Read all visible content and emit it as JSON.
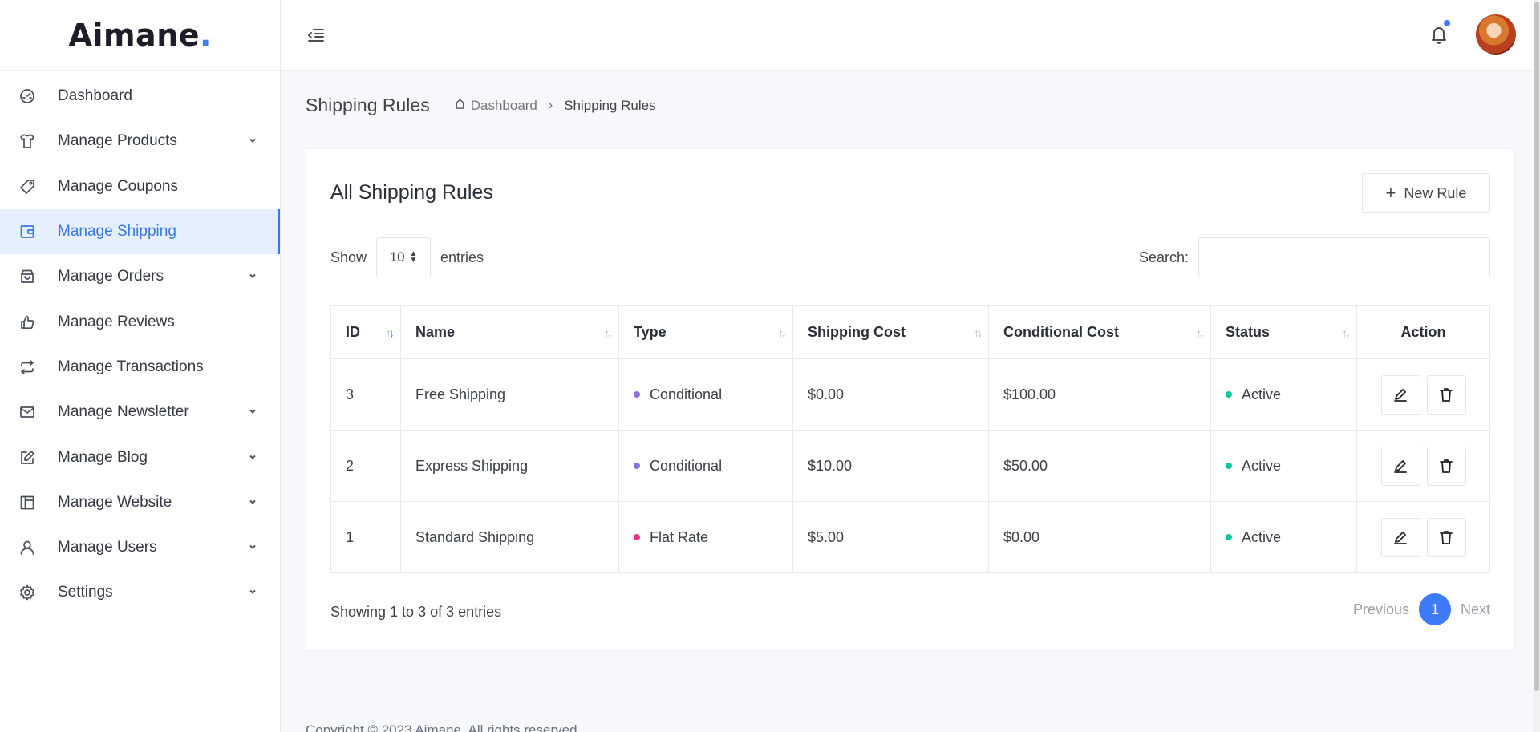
{
  "brand": {
    "name": "Aimane",
    "dot": "."
  },
  "sidebar": {
    "items": [
      {
        "label": "Dashboard",
        "icon": "dashboard-icon",
        "chevron": false,
        "active": false
      },
      {
        "label": "Manage Products",
        "icon": "shirt-icon",
        "chevron": true,
        "active": false
      },
      {
        "label": "Manage Coupons",
        "icon": "tag-icon",
        "chevron": false,
        "active": false
      },
      {
        "label": "Manage Shipping",
        "icon": "wallet-icon",
        "chevron": false,
        "active": true
      },
      {
        "label": "Manage Orders",
        "icon": "shopping-bag-icon",
        "chevron": true,
        "active": false
      },
      {
        "label": "Manage Reviews",
        "icon": "thumbs-up-icon",
        "chevron": false,
        "active": false
      },
      {
        "label": "Manage Transactions",
        "icon": "repeat-icon",
        "chevron": false,
        "active": false
      },
      {
        "label": "Manage Newsletter",
        "icon": "mail-icon",
        "chevron": true,
        "active": false
      },
      {
        "label": "Manage Blog",
        "icon": "edit-icon",
        "chevron": true,
        "active": false
      },
      {
        "label": "Manage Website",
        "icon": "layout-icon",
        "chevron": true,
        "active": false
      },
      {
        "label": "Manage Users",
        "icon": "user-icon",
        "chevron": true,
        "active": false
      },
      {
        "label": "Settings",
        "icon": "gear-icon",
        "chevron": true,
        "active": false
      }
    ]
  },
  "header": {
    "menu_icon": "menu-toggle-icon",
    "bell_icon": "bell-icon",
    "accent": "#3e7bfa"
  },
  "page": {
    "title": "Shipping Rules",
    "breadcrumb": {
      "home": "Dashboard",
      "current": "Shipping Rules"
    }
  },
  "card": {
    "title": "All Shipping Rules",
    "new_button": "New Rule",
    "show_label": "Show",
    "entries_value": "10",
    "entries_label": "entries",
    "search_label": "Search:",
    "search_value": ""
  },
  "table": {
    "columns": [
      "ID",
      "Name",
      "Type",
      "Shipping Cost",
      "Conditional Cost",
      "Status",
      "Action"
    ],
    "rows": [
      {
        "id": "3",
        "name": "Free Shipping",
        "type": "Conditional",
        "type_color": "#8b6fe8",
        "shipping_cost": "$0.00",
        "conditional_cost": "$100.00",
        "status": "Active",
        "status_color": "#12c4a0"
      },
      {
        "id": "2",
        "name": "Express Shipping",
        "type": "Conditional",
        "type_color": "#8b6fe8",
        "shipping_cost": "$10.00",
        "conditional_cost": "$50.00",
        "status": "Active",
        "status_color": "#12c4a0"
      },
      {
        "id": "1",
        "name": "Standard Shipping",
        "type": "Flat Rate",
        "type_color": "#e8358c",
        "shipping_cost": "$5.00",
        "conditional_cost": "$0.00",
        "status": "Active",
        "status_color": "#12c4a0"
      }
    ]
  },
  "pagination": {
    "info": "Showing 1 to 3 of 3 entries",
    "previous": "Previous",
    "current_page": "1",
    "next": "Next"
  },
  "footer": {
    "text": "Copyright © 2023 Aimane. All rights reserved."
  }
}
